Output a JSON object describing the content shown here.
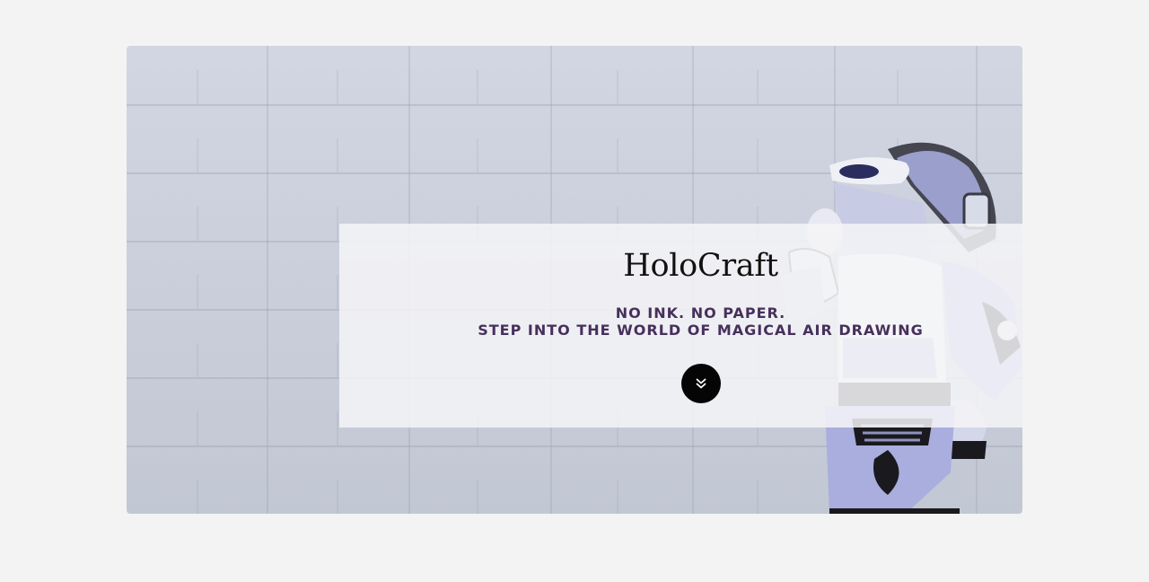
{
  "hero": {
    "title": "HoloCraft",
    "tagline_line1": "NO INK. NO PAPER.",
    "tagline_line2": "STEP INTO THE WORLD OF MAGICAL AIR DRAWING",
    "scroll_icon": "double-chevron-down-icon"
  },
  "colors": {
    "page_bg": "#f3f3f3",
    "tagline": "#47305c",
    "button_bg": "#050505",
    "robot_body": "#a9aede",
    "robot_dark": "#1a1a1e"
  }
}
